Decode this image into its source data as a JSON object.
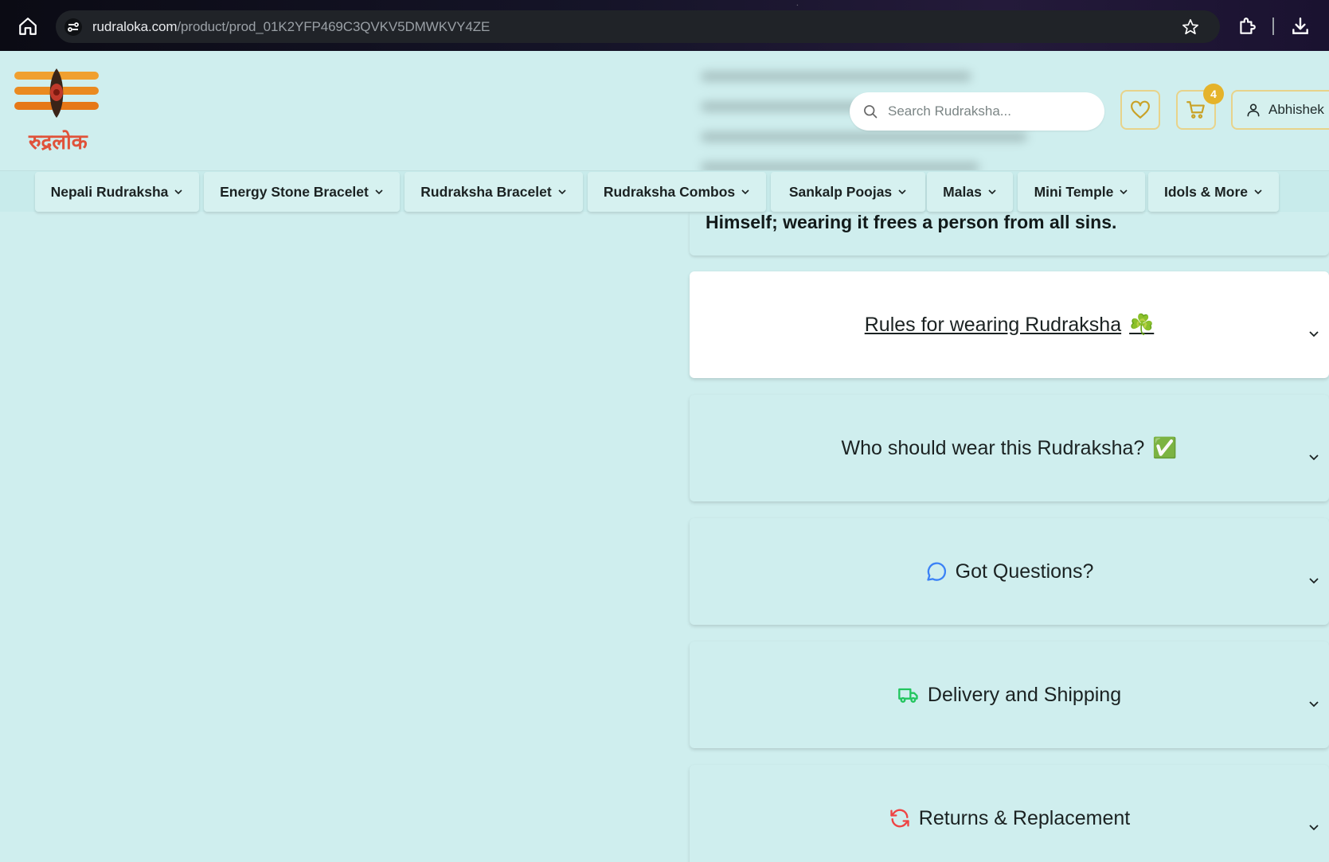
{
  "browser": {
    "url_domain": "rudraloka.com",
    "url_path": "/product/prod_01K2YFP469C3QVKV5DMWKVY4ZE"
  },
  "header": {
    "logo_text": "रुद्रलोक",
    "search_placeholder": "Search Rudraksha...",
    "cart_count": "4",
    "account_name": "Abhishek"
  },
  "nav": {
    "items": [
      {
        "label": "Nepali Rudraksha"
      },
      {
        "label": "Energy Stone Bracelet"
      },
      {
        "label": "Rudraksha Bracelet"
      },
      {
        "label": "Rudraksha Combos"
      },
      {
        "label": "Sankalp Poojas"
      },
      {
        "label": "Malas"
      },
      {
        "label": "Mini Temple"
      },
      {
        "label": "Idols & More"
      }
    ]
  },
  "content": {
    "hero_text": "Himself; wearing it frees a person from all sins.",
    "accordions": [
      {
        "title": "Rules for wearing Rudraksha",
        "emoji": "☘️",
        "open": true
      },
      {
        "title": "Who should wear this Rudraksha?",
        "emoji": "✅",
        "open": false
      },
      {
        "title": "Got Questions?",
        "icon": "chat-bubble-icon",
        "open": false
      },
      {
        "title": "Delivery and Shipping",
        "icon": "truck-icon",
        "open": false
      },
      {
        "title": "Returns & Replacement",
        "icon": "refresh-icon",
        "open": false
      }
    ]
  },
  "colors": {
    "page_bg": "#cfeeee",
    "accent_gold": "#e5b32a",
    "chat_blue": "#3b82f6",
    "truck_green": "#22c55e",
    "refresh_red": "#ef4444"
  }
}
